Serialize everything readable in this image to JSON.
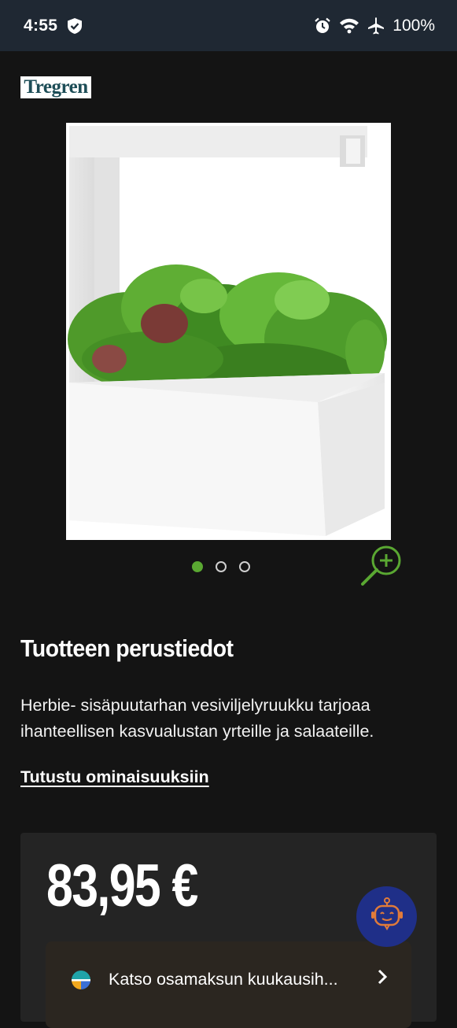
{
  "status_bar": {
    "time": "4:55",
    "battery": "100%",
    "icons": [
      "shield-icon",
      "alarm-icon",
      "wifi-icon",
      "airplane-icon"
    ]
  },
  "brand": {
    "logo_text": "Tregren"
  },
  "gallery": {
    "image_count": 3,
    "active_index": 0,
    "accent_color": "#5aa832"
  },
  "info": {
    "title": "Tuotteen perustiedot",
    "description": "Herbie- sisäpuutarhan vesiviljelyruukku tarjoaa ihanteellisen kasvualustan yrteille ja salaateille.",
    "features_link": "Tutustu ominaisuuksiin"
  },
  "price": {
    "amount": "83,95 €",
    "installment_label": "Katso osamaksun kuukausih..."
  },
  "chatbot": {
    "icon": "robot-icon",
    "color": "#1f2f88"
  }
}
